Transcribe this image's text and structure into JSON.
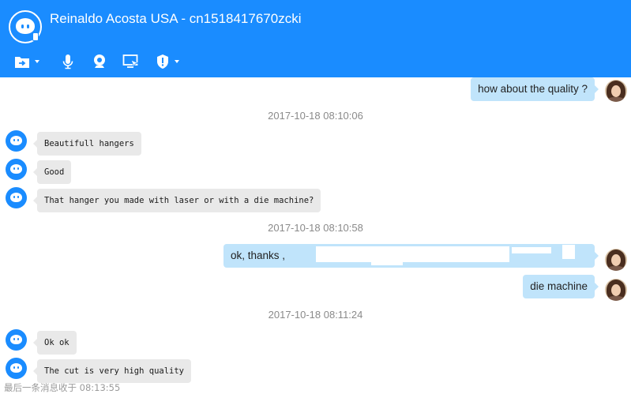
{
  "header": {
    "title": "Reinaldo Acosta  USA - cn1518417670zcki",
    "bg_color": "#1a8cff",
    "toolbar": [
      {
        "icon": "send-file-icon",
        "has_dropdown": true
      },
      {
        "icon": "microphone-icon",
        "has_dropdown": false
      },
      {
        "icon": "webcam-icon",
        "has_dropdown": false
      },
      {
        "icon": "remote-screen-icon",
        "has_dropdown": false
      },
      {
        "icon": "shield-icon",
        "has_dropdown": true
      }
    ]
  },
  "messages": [
    {
      "type": "out",
      "text": "how about the quality ?"
    },
    {
      "type": "timestamp",
      "text": "2017-10-18 08:10:06"
    },
    {
      "type": "in",
      "text": "Beautifull hangers"
    },
    {
      "type": "in",
      "text": "Good"
    },
    {
      "type": "in",
      "text": "That hanger you made with laser or with a die machine?"
    },
    {
      "type": "timestamp",
      "text": "2017-10-18 08:10:58"
    },
    {
      "type": "out",
      "text": "ok, thanks ,"
    },
    {
      "type": "out",
      "text": "die machine"
    },
    {
      "type": "timestamp",
      "text": "2017-10-18 08:11:24"
    },
    {
      "type": "in",
      "text": "Ok ok"
    },
    {
      "type": "in",
      "text": "The cut is very high quality"
    }
  ],
  "footer": {
    "last_message": "最后一条消息收于 08:13:55"
  },
  "colors": {
    "incoming_bubble": "#e9e9e9",
    "outgoing_bubble": "#c0e4fb",
    "timestamp": "#8a8a8a"
  }
}
